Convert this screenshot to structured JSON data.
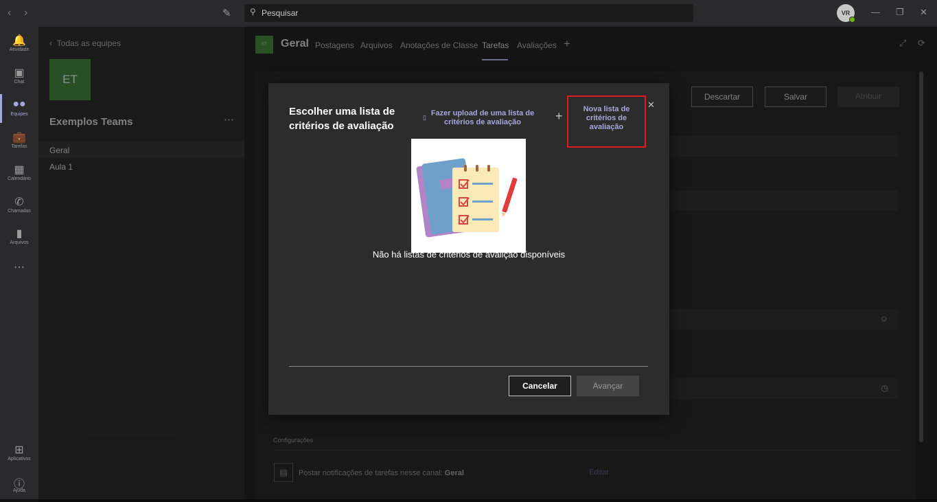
{
  "titlebar": {
    "search_placeholder": "Pesquisar",
    "avatar_initials": "VR"
  },
  "rail": {
    "items": [
      {
        "label": "Atividade",
        "icon": "bell-icon"
      },
      {
        "label": "Chat",
        "icon": "chat-icon"
      },
      {
        "label": "Equipes",
        "icon": "teams-icon"
      },
      {
        "label": "Tarefas",
        "icon": "assignments-icon"
      },
      {
        "label": "Calendário",
        "icon": "calendar-icon"
      },
      {
        "label": "Chamadas",
        "icon": "phone-icon"
      },
      {
        "label": "Arquivos",
        "icon": "files-icon"
      },
      {
        "label": "Aplicativos",
        "icon": "apps-icon"
      },
      {
        "label": "Ajuda",
        "icon": "help-icon"
      }
    ]
  },
  "team_panel": {
    "back_label": "Todas as equipes",
    "team_initials": "ET",
    "team_name": "Exemplos Teams",
    "channels": [
      "Geral",
      "Aula 1"
    ]
  },
  "channel_header": {
    "initials": "ET",
    "title": "Geral",
    "tabs": [
      "Postagens",
      "Arquivos",
      "Anotações de Classe",
      "Tarefas",
      "Avaliações"
    ],
    "active_tab": "Tarefas"
  },
  "assignment": {
    "discard_label": "Descartar",
    "save_label": "Salvar",
    "assign_label": "Atribuir",
    "settings_label": "Configurações",
    "post_notification_text": "Postar notificações de tarefas nesse canal:",
    "post_notification_channel": "Geral",
    "edit_label": "Editar"
  },
  "dialog": {
    "title": "Escolher uma lista de critérios de avaliação",
    "upload_label": "Fazer upload de uma lista de critérios de avaliação",
    "new_label": "Nova lista de critérios de avaliação",
    "empty_text": "Não há listas de critérios de avalição disponíveis",
    "cancel_label": "Cancelar",
    "next_label": "Avançar",
    "highlight_color": "#e01e1e",
    "accent_color": "#a6a7dc"
  }
}
